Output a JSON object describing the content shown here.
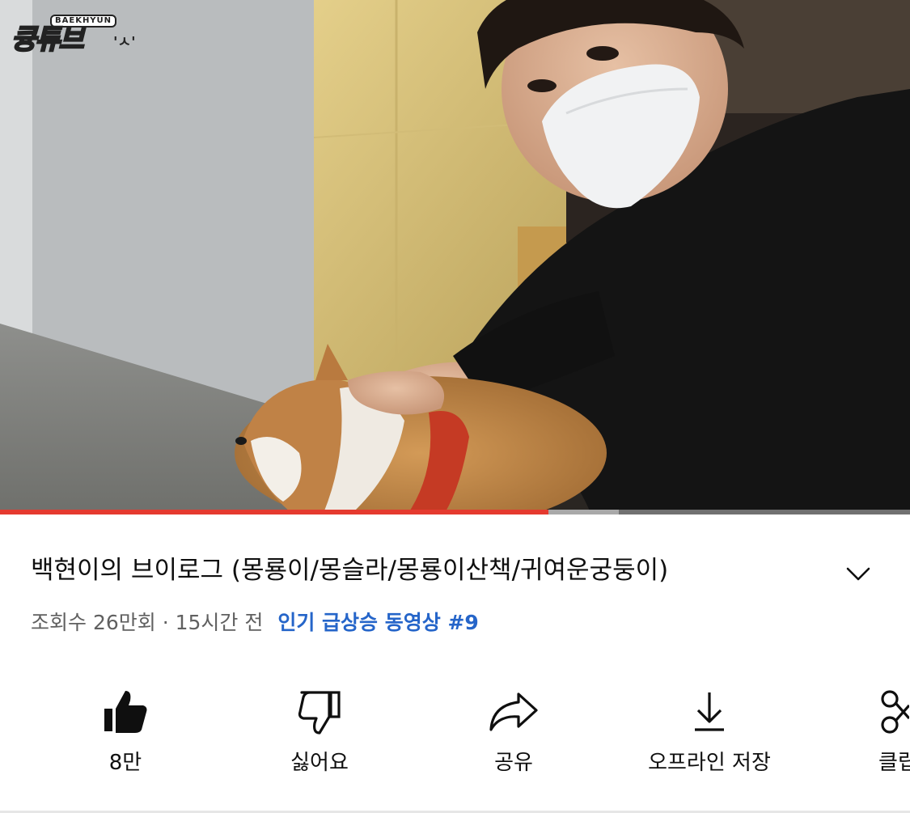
{
  "video": {
    "watermark_small": "BAEKHYUN",
    "watermark_big": "큥튜브",
    "watermark_tag": "'ㅅ'",
    "progress_played": 0.603,
    "progress_buffered": 0.68
  },
  "details": {
    "title": "백현이의 브이로그 (몽룡이/몽슬라/몽룡이산책/귀여운궁둥이)",
    "views": "조회수 26만회",
    "separator": "·",
    "time": "15시간 전",
    "trending": "인기 급상승 동영상 #9",
    "expand_icon": "chevron-down-icon"
  },
  "actions": [
    {
      "label": "8만",
      "icon": "thumbs-up-filled-icon"
    },
    {
      "label": "싫어요",
      "icon": "thumbs-down-icon"
    },
    {
      "label": "공유",
      "icon": "share-icon"
    },
    {
      "label": "오프라인 저장",
      "icon": "download-icon"
    },
    {
      "label": "클립",
      "icon": "scissors-icon"
    }
  ],
  "colors": {
    "progress_red": "#e53a2f",
    "trend_blue": "#2565c9",
    "meta_gray": "#606060"
  }
}
